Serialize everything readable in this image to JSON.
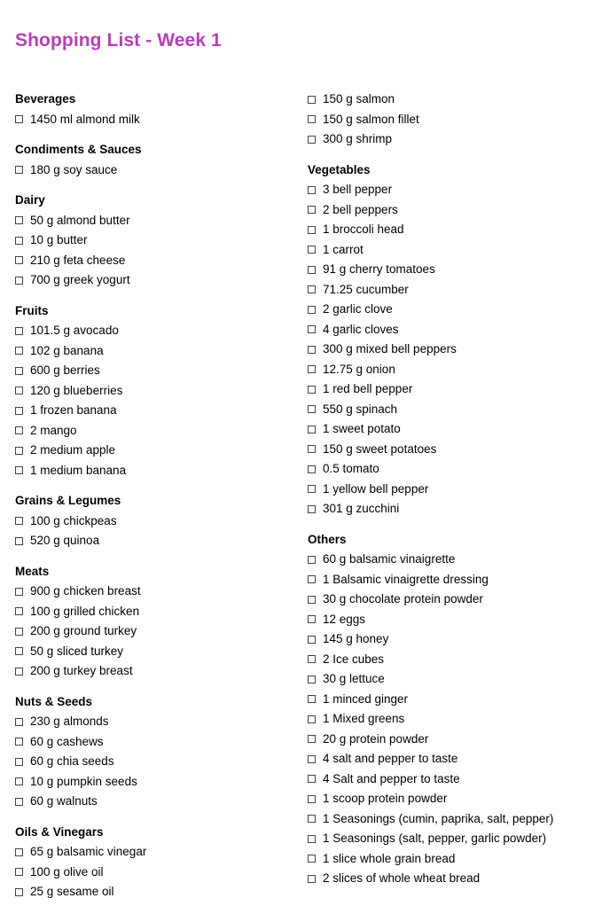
{
  "document": {
    "title": "Shopping List - Week 1",
    "title_color": "#b83dba",
    "background_color": "#ffffff",
    "checkbox_icon": "unchecked-checkbox-icon"
  },
  "columns": [
    {
      "id": "left-column",
      "lead_items": [],
      "sections": [
        {
          "heading": "Beverages",
          "items": [
            "1450 ml almond milk"
          ]
        },
        {
          "heading": "Condiments & Sauces",
          "items": [
            "180 g soy sauce"
          ]
        },
        {
          "heading": "Dairy",
          "items": [
            "50 g almond butter",
            "10 g butter",
            "210 g feta cheese",
            "700 g greek yogurt"
          ]
        },
        {
          "heading": "Fruits",
          "items": [
            "101.5 g avocado",
            "102 g banana",
            "600 g berries",
            "120 g blueberries",
            "1 frozen banana",
            "2 mango",
            "2 medium apple",
            "1 medium banana"
          ]
        },
        {
          "heading": "Grains & Legumes",
          "items": [
            "100 g chickpeas",
            "520 g quinoa"
          ]
        },
        {
          "heading": "Meats",
          "items": [
            "900 g chicken breast",
            "100 g grilled chicken",
            "200 g ground turkey",
            "50 g sliced turkey",
            "200 g turkey breast"
          ]
        },
        {
          "heading": "Nuts & Seeds",
          "items": [
            "230 g almonds",
            "60 g cashews",
            "60 g chia seeds",
            "10 g pumpkin seeds",
            "60 g walnuts"
          ]
        },
        {
          "heading": "Oils & Vinegars",
          "items": [
            "65 g balsamic vinegar",
            "100 g olive oil",
            "25 g sesame oil"
          ]
        }
      ]
    },
    {
      "id": "right-column",
      "lead_items": [
        "150 g salmon",
        "150 g salmon fillet",
        "300 g shrimp"
      ],
      "sections": [
        {
          "heading": "Vegetables",
          "items": [
            "3 bell pepper",
            "2 bell peppers",
            "1 broccoli head",
            "1 carrot",
            "91 g cherry tomatoes",
            "71.25 cucumber",
            "2 garlic clove",
            "4 garlic cloves",
            "300 g mixed bell peppers",
            "12.75 g onion",
            "1 red bell pepper",
            "550 g spinach",
            "1 sweet potato",
            "150 g sweet potatoes",
            "0.5 tomato",
            "1 yellow bell pepper",
            "301 g zucchini"
          ]
        },
        {
          "heading": "Others",
          "items": [
            "60 g balsamic vinaigrette",
            "1 Balsamic vinaigrette dressing",
            "30 g chocolate protein powder",
            "12 eggs",
            "145 g honey",
            "2 Ice cubes",
            "30 g lettuce",
            "1 minced ginger",
            "1 Mixed greens",
            "20 g protein powder",
            "4 salt and pepper to taste",
            "4 Salt and pepper to taste",
            "1 scoop protein powder",
            "1 Seasonings (cumin, paprika, salt, pepper)",
            "1 Seasonings (salt, pepper, garlic powder)",
            "1 slice whole grain bread",
            "2 slices of whole wheat bread"
          ]
        }
      ]
    }
  ]
}
